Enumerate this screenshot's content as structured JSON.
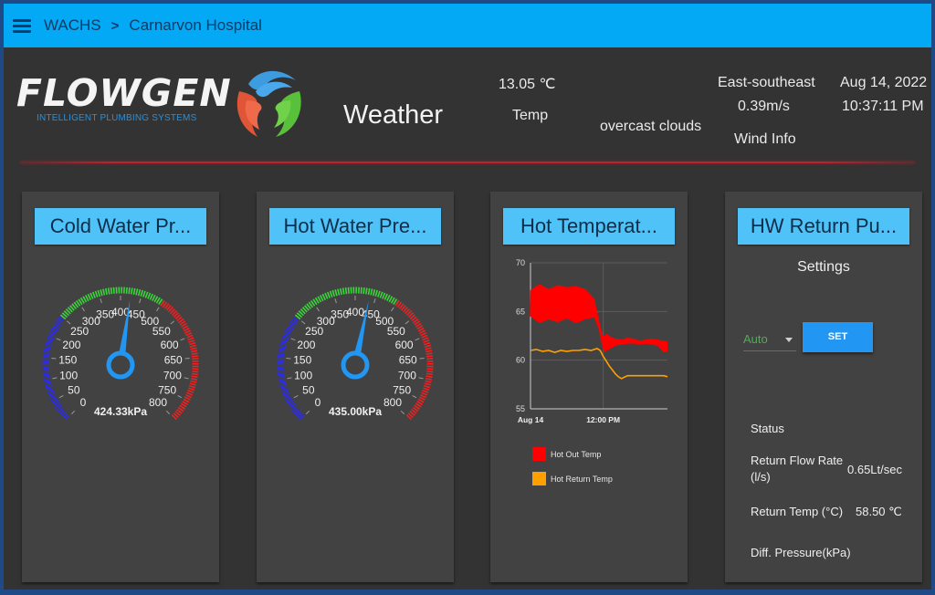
{
  "topbar": {
    "menu_icon": "hamburger-menu-icon",
    "breadcrumb": [
      "WACHS",
      "Carnarvon Hospital"
    ],
    "separator": ">"
  },
  "header": {
    "logo_text": "FLOWGEN",
    "logo_subtitle": "INTELLIGENT PLUMBING SYSTEMS",
    "section_title": "Weather",
    "temperature": {
      "value": "13.05 ℃",
      "label": "Temp"
    },
    "condition": "overcast clouds",
    "wind": {
      "direction": "East-southeast",
      "speed": "0.39m/s",
      "label": "Wind Info"
    },
    "date": "Aug 14, 2022",
    "time": "10:37:11 PM"
  },
  "colors": {
    "topbar": "#03a9f4",
    "card_title_bg": "#4fc3f7",
    "set_button": "#2196f3",
    "gauge_low": "#2a2af0",
    "gauge_mid": "#3ad63a",
    "gauge_high": "#f02020",
    "needle": "#2196f3",
    "auto_text": "#4caf50"
  },
  "cards": [
    {
      "title": "Cold Water Pr...",
      "gauge": {
        "min": 0,
        "max": 800,
        "step": 50,
        "value": 424.33,
        "unit": "kPa",
        "readout": "424.33kPa",
        "bands": [
          {
            "from": 0,
            "to": 250,
            "color": "low"
          },
          {
            "from": 250,
            "to": 500,
            "color": "mid"
          },
          {
            "from": 500,
            "to": 800,
            "color": "high"
          }
        ]
      }
    },
    {
      "title": "Hot Water Pre...",
      "gauge": {
        "min": 0,
        "max": 800,
        "step": 50,
        "value": 435.0,
        "unit": "kPa",
        "readout": "435.00kPa",
        "bands": [
          {
            "from": 0,
            "to": 250,
            "color": "low"
          },
          {
            "from": 250,
            "to": 500,
            "color": "mid"
          },
          {
            "from": 500,
            "to": 800,
            "color": "high"
          }
        ]
      }
    },
    {
      "title": "Hot Temperat..."
    },
    {
      "title": "HW Return Pu...",
      "settings_label": "Settings",
      "mode_select": {
        "value": "Auto"
      },
      "set_button": "SET",
      "status_label": "Status",
      "stats": [
        {
          "label": "Return Flow Rate (l/s)",
          "value": "0.65Lt/sec"
        },
        {
          "label": "Return Temp (°C)",
          "value": "58.50 ℃"
        },
        {
          "label": "Diff. Pressure(kPa)",
          "value": ""
        }
      ]
    }
  ],
  "chart_data": {
    "type": "line",
    "title": "Hot Temperat...",
    "xlabel": "",
    "ylabel": "",
    "x_range_hours": [
      0,
      22.6
    ],
    "xticks": [
      {
        "hour": 0,
        "label": "Aug 14"
      },
      {
        "hour": 12,
        "label": "12:00 PM"
      }
    ],
    "ylim": [
      55,
      70
    ],
    "yticks": [
      55,
      60,
      65,
      70
    ],
    "grid": true,
    "legend_position": "bottom",
    "series": [
      {
        "name": "Hot Out Temp",
        "color": "#ff0000",
        "band": true,
        "x": [
          0,
          1.5,
          3,
          4.5,
          6,
          7.5,
          9,
          10.5,
          11.3,
          11.8,
          12.2,
          12.6,
          13.2,
          14,
          15,
          16,
          17,
          18,
          19,
          20,
          21,
          22,
          22.6
        ],
        "low": [
          64.5,
          63.8,
          64.2,
          63.9,
          64.3,
          63.8,
          64.2,
          64.4,
          63.2,
          61.6,
          60.8,
          61.0,
          61.2,
          61.5,
          61.6,
          61.7,
          61.7,
          61.6,
          61.7,
          61.6,
          61.5,
          60.8,
          60.9
        ],
        "high": [
          67.2,
          67.8,
          67.3,
          67.7,
          67.5,
          67.6,
          67.3,
          66.3,
          64.0,
          62.6,
          62.5,
          62.7,
          62.4,
          62.2,
          62.1,
          62.3,
          62.2,
          62.0,
          62.1,
          62.2,
          62.1,
          62.0,
          61.9
        ]
      },
      {
        "name": "Hot Return Temp",
        "color": "#ffa000",
        "x": [
          0,
          1,
          2,
          3,
          4,
          5,
          6,
          7,
          8,
          9,
          10,
          11,
          11.5,
          12,
          12.5,
          13,
          13.5,
          14,
          14.5,
          15,
          16,
          17,
          18,
          19,
          20,
          21,
          22,
          22.6
        ],
        "values": [
          61.0,
          61.1,
          60.9,
          61.0,
          60.8,
          61.0,
          60.9,
          61.0,
          61.0,
          61.1,
          61.0,
          61.2,
          61.0,
          60.4,
          59.9,
          59.4,
          59.0,
          58.6,
          58.3,
          58.1,
          58.4,
          58.4,
          58.4,
          58.4,
          58.4,
          58.4,
          58.4,
          58.3
        ]
      }
    ]
  }
}
